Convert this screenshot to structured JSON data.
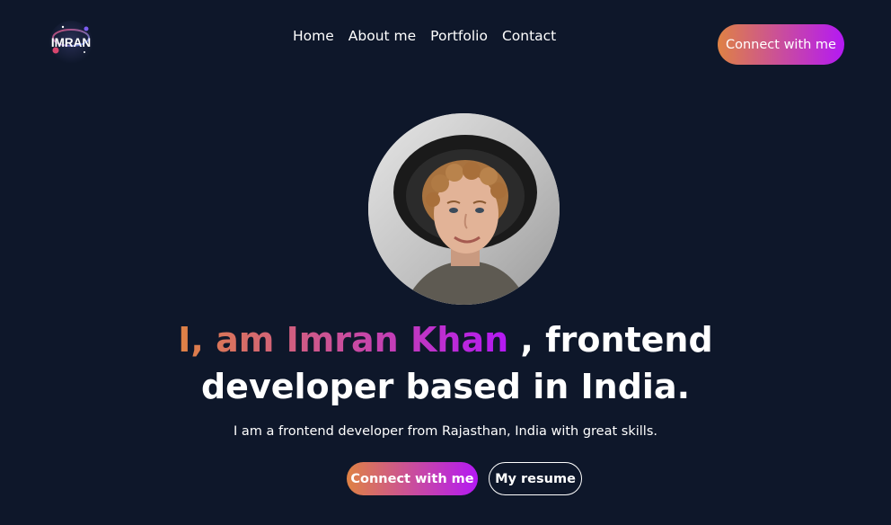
{
  "header": {
    "logo_text": "IMRAN",
    "nav": [
      "Home",
      "About me",
      "Portfolio",
      "Contact"
    ],
    "cta_label": "Connect with me"
  },
  "hero": {
    "headline_highlight": "I, am Imran Khan",
    "headline_rest": " , frontend",
    "headline_line2": "developer based in India.",
    "subtitle": "I am a frontend developer from Rajasthan, India with great skills.",
    "primary_button": "Connect with me",
    "secondary_button": "My resume"
  },
  "colors": {
    "background": "#0e172a",
    "gradient_start": "#df8244",
    "gradient_end": "#b419f4",
    "text": "#ffffff"
  },
  "icons": {
    "logo": "imran-logo-icon",
    "avatar": "profile-photo"
  }
}
